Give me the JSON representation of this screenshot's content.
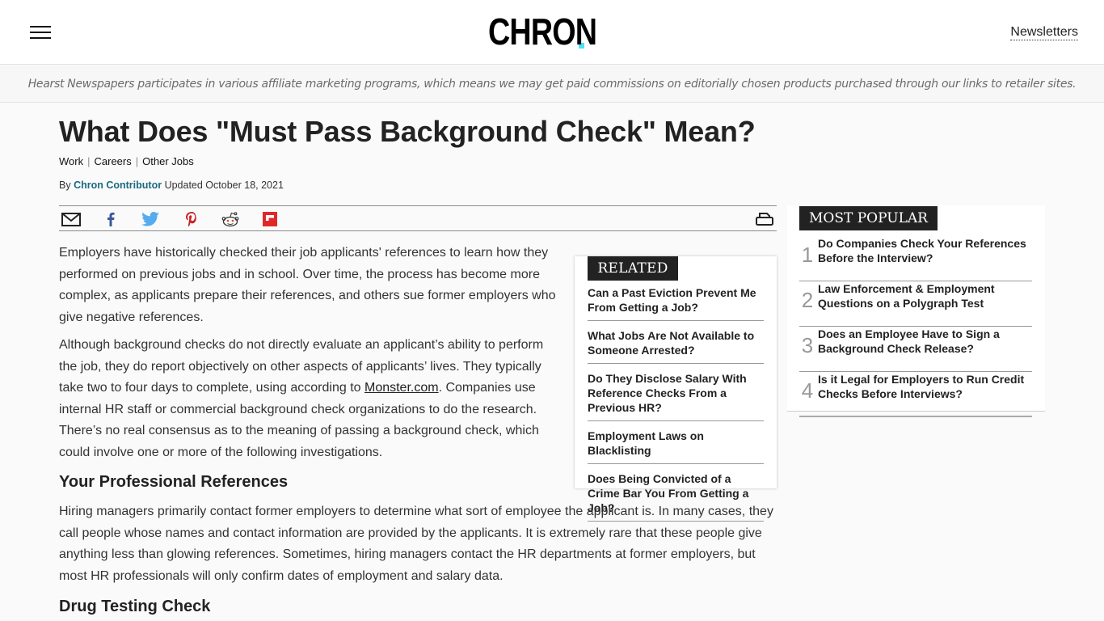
{
  "header": {
    "logo_text": "CHRON",
    "logo_dot_color": "#4de0f5",
    "newsletters_label": "Newsletters"
  },
  "affiliate_notice": "Hearst Newspapers participates in various affiliate marketing programs, which means we may get paid commissions on editorially chosen products purchased through our links to retailer sites.",
  "article": {
    "title": "What Does \"Must Pass Background Check\" Mean?",
    "categories": [
      "Work",
      "Careers",
      "Other Jobs"
    ],
    "category_separator": "|",
    "byline_prefix": "By",
    "author": "Chron Contributor",
    "updated": "Updated October 18, 2021",
    "share_icons": [
      "email-icon",
      "facebook-icon",
      "twitter-icon",
      "pinterest-icon",
      "reddit-icon",
      "flipboard-icon"
    ],
    "print_icon": "print-icon",
    "paragraph1": "Employers have historically checked their job applicants' references to learn how they performed on previous jobs and in school. Over time, the process has become more complex, as applicants prepare their references, and others sue former employers who give negative references.",
    "paragraph2_before_link": "Although background checks do not directly evaluate an applicant’s ability to perform the job, they do report objectively on other aspects of applicants’ lives. They typically take two to four days to complete, using according to ",
    "paragraph2_link": "Monster.com",
    "paragraph2_after_link": ". Companies use internal HR staff or commercial background check organizations to do the research. There’s no real consensus as to the meaning of passing a background check, which could involve one or more of the following investigations.",
    "heading1": "Your Professional References",
    "paragraph3": "Hiring managers primarily contact former employers to determine what sort of employee the applicant is. In many cases, they call people whose names and contact information are provided by the applicants. It is extremely rare that these people give anything less than glowing references. Sometimes, hiring managers contact the HR departments at former employers, but most HR professionals will only confirm dates of employment and salary data.",
    "heading2": "Drug Testing Check"
  },
  "related": {
    "label": "RELATED",
    "items": [
      "Can a Past Eviction Prevent Me From Getting a Job?",
      "What Jobs Are Not Available to Someone Arrested?",
      "Do They Disclose Salary With Reference Checks From a Previous HR?",
      "Employment Laws on Blacklisting",
      "Does Being Convicted of a Crime Bar You From Getting a Job?"
    ]
  },
  "most_popular": {
    "label": "MOST POPULAR",
    "items": [
      {
        "num": "1",
        "title": "Do Companies Check Your References Before the Interview?"
      },
      {
        "num": "2",
        "title": "Law Enforcement & Employment Questions on a Polygraph Test"
      },
      {
        "num": "3",
        "title": "Does an Employee Have to Sign a Background Check Release?"
      },
      {
        "num": "4",
        "title": "Is it Legal for Employers to Run Credit Checks Before Interviews?"
      }
    ]
  },
  "colors": {
    "author_link": "#1a6a80",
    "facebook": "#3b5998",
    "twitter": "#55acee",
    "pinterest": "#cb2027",
    "flipboard": "#e12828"
  }
}
